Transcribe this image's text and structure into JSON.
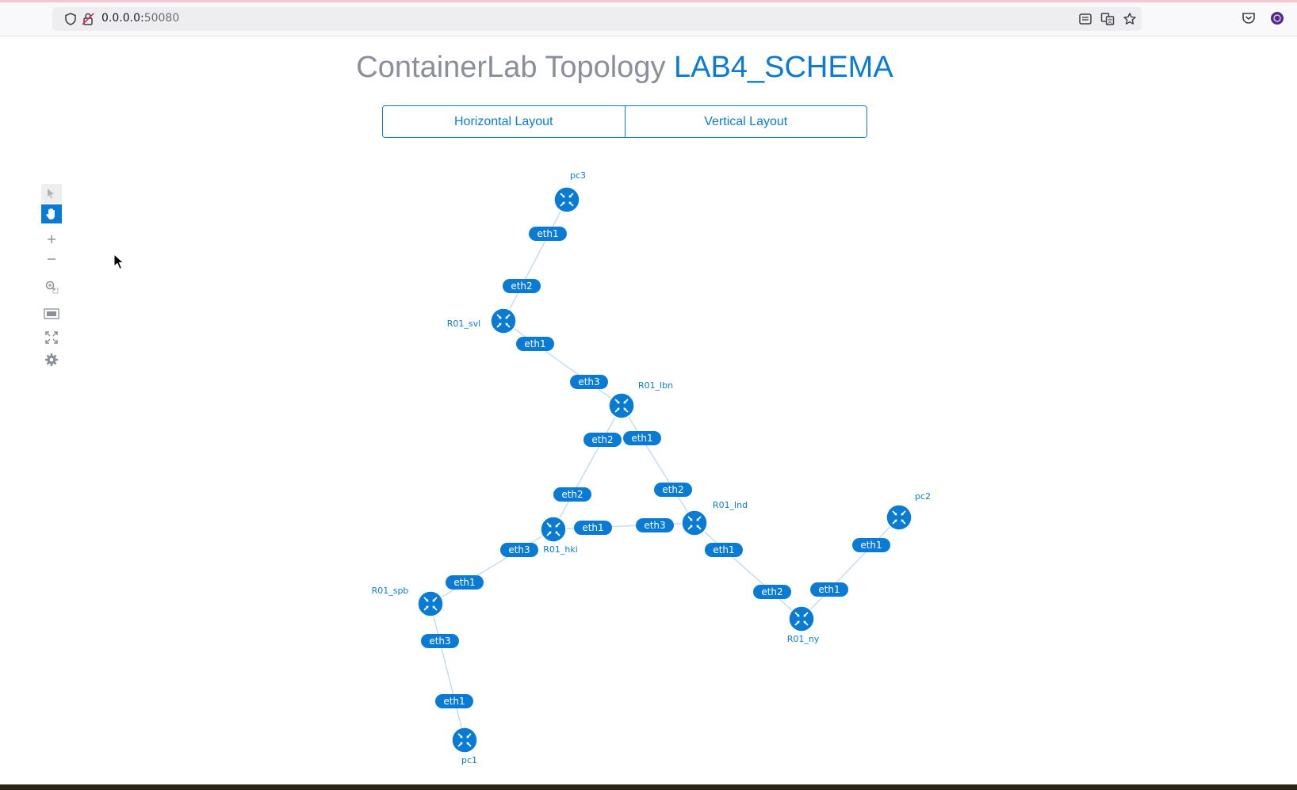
{
  "browser": {
    "url_host": "0.0.0.0:",
    "url_port": "50080",
    "icons": [
      "shield-icon",
      "insecure-lock-icon",
      "reader-view-icon",
      "translate-icon",
      "bookmark-star-icon",
      "pocket-icon",
      "extension-icon"
    ]
  },
  "header": {
    "title_prefix": "ContainerLab Topology",
    "lab_name": "LAB4_SCHEMA",
    "horizontal_label": "Horizontal Layout",
    "vertical_label": "Vertical Layout"
  },
  "toolbar": {
    "tools": [
      "select-icon",
      "pan-hand-icon",
      "zoom-in-icon",
      "zoom-out-icon",
      "zoom-selection-icon",
      "fit-view-icon",
      "fullscreen-icon",
      "settings-gear-icon"
    ],
    "active_tool": "pan-hand-icon"
  },
  "colors": {
    "accent": "#0a7bd4",
    "link": "#c6dcf2",
    "title": "#8a8f99"
  },
  "topology": {
    "nodes": [
      {
        "id": "pc3",
        "label": "pc3"
      },
      {
        "id": "R01_svl",
        "label": "R01_svl"
      },
      {
        "id": "R01_lbn",
        "label": "R01_lbn"
      },
      {
        "id": "R01_lnd",
        "label": "R01_lnd"
      },
      {
        "id": "R01_hki",
        "label": "R01_hki"
      },
      {
        "id": "R01_spb",
        "label": "R01_spb"
      },
      {
        "id": "pc1",
        "label": "pc1"
      },
      {
        "id": "pc2",
        "label": "pc2"
      },
      {
        "id": "R01_ny",
        "label": "R01_ny"
      }
    ],
    "links": [
      {
        "a": "pc3",
        "a_port": "eth1",
        "b": "R01_svl",
        "b_port": "eth2"
      },
      {
        "a": "R01_svl",
        "a_port": "eth1",
        "b": "R01_lbn",
        "b_port": "eth3"
      },
      {
        "a": "R01_lbn",
        "a_port": "eth2",
        "b": "R01_hki",
        "b_port": "eth2"
      },
      {
        "a": "R01_lbn",
        "a_port": "eth1",
        "b": "R01_lnd",
        "b_port": "eth2"
      },
      {
        "a": "R01_hki",
        "a_port": "eth1",
        "b": "R01_lnd",
        "b_port": "eth3"
      },
      {
        "a": "R01_hki",
        "a_port": "eth3",
        "b": "R01_spb",
        "b_port": "eth1"
      },
      {
        "a": "R01_spb",
        "a_port": "eth3",
        "b": "pc1",
        "b_port": "eth1"
      },
      {
        "a": "R01_lnd",
        "a_port": "eth1",
        "b": "R01_ny",
        "b_port": "eth2"
      },
      {
        "a": "R01_ny",
        "a_port": "eth1",
        "b": "pc2",
        "b_port": "eth1"
      }
    ]
  }
}
